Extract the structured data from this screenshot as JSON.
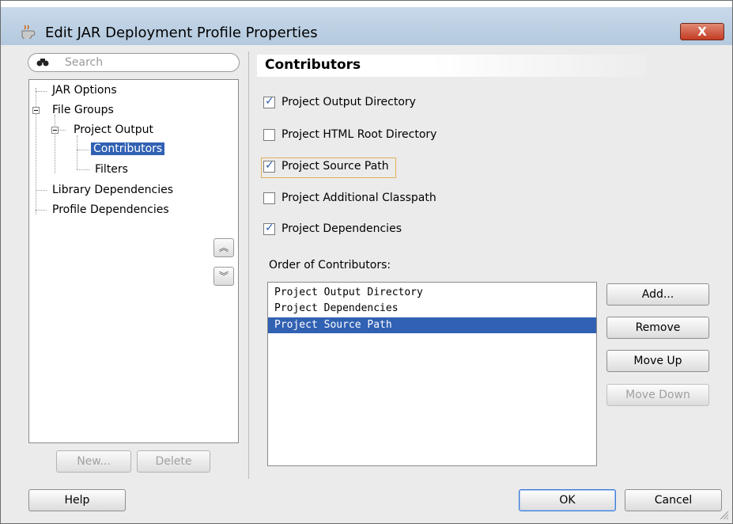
{
  "window": {
    "title": "Edit JAR Deployment Profile Properties",
    "close_label": "X"
  },
  "search": {
    "placeholder": "Search"
  },
  "tree": {
    "items": [
      {
        "label": "JAR Options"
      },
      {
        "label": "File Groups"
      },
      {
        "label": "Project Output"
      },
      {
        "label": "Contributors"
      },
      {
        "label": "Filters"
      },
      {
        "label": "Library Dependencies"
      },
      {
        "label": "Profile Dependencies"
      }
    ],
    "selected": "Contributors"
  },
  "left_buttons": {
    "new": "New...",
    "delete": "Delete"
  },
  "panel": {
    "title": "Contributors",
    "checkboxes": [
      {
        "label": "Project Output Directory",
        "checked": true
      },
      {
        "label": "Project HTML Root Directory",
        "checked": false
      },
      {
        "label": "Project Source Path",
        "checked": true
      },
      {
        "label": "Project Additional Classpath",
        "checked": false
      },
      {
        "label": "Project Dependencies",
        "checked": true
      }
    ],
    "order_label": "Order of Contributors:",
    "order_items": [
      "Project Output Directory",
      "Project Dependencies",
      "Project Source Path"
    ],
    "order_selected": "Project Source Path",
    "buttons": {
      "add": "Add...",
      "remove": "Remove",
      "move_up": "Move Up",
      "move_down": "Move Down"
    }
  },
  "footer": {
    "help": "Help",
    "ok": "OK",
    "cancel": "Cancel"
  },
  "colors": {
    "selection": "#3161b3",
    "titlebar": "#c8d9ea",
    "close": "#c43b22"
  }
}
